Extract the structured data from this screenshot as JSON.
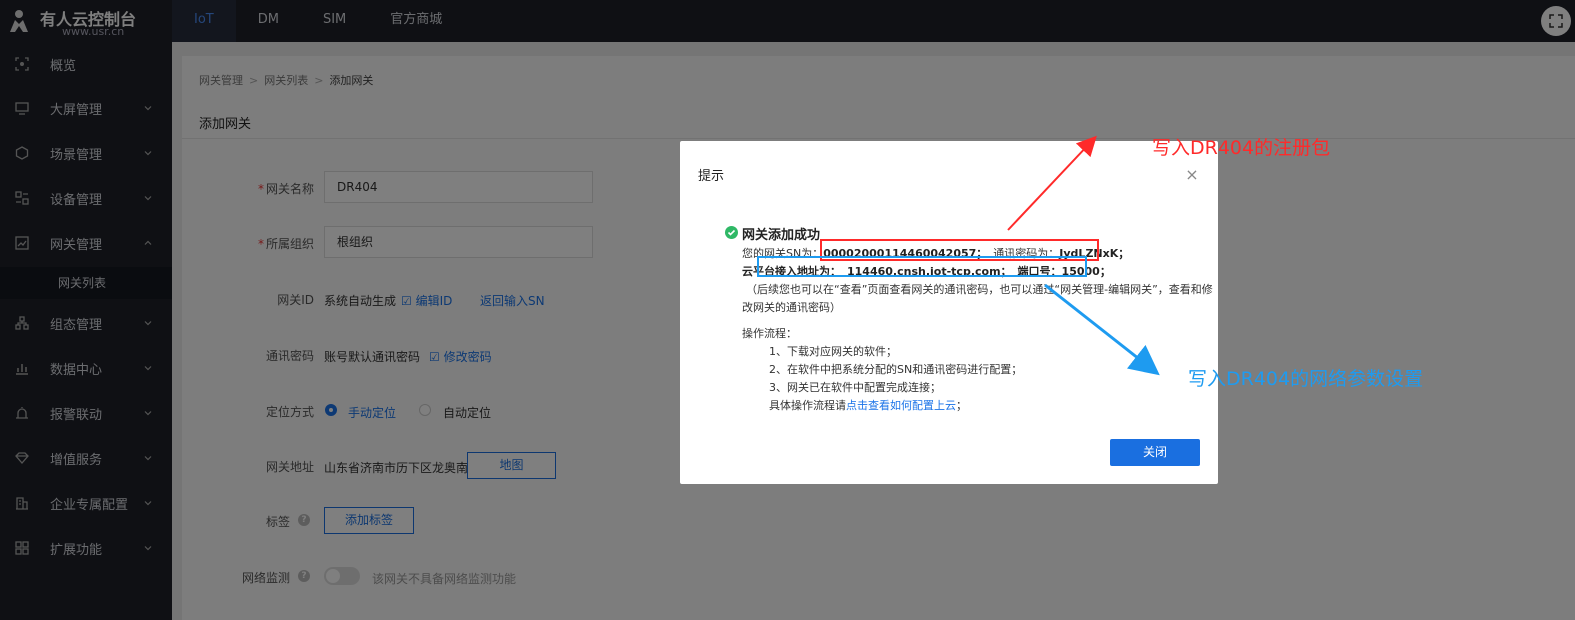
{
  "header": {
    "logo_title": "有人云控制台",
    "logo_url": "www.usr.cn",
    "nav": [
      {
        "label": "IoT",
        "active": true
      },
      {
        "label": "DM",
        "active": false
      },
      {
        "label": "SIM",
        "active": false
      },
      {
        "label": "官方商城",
        "active": false
      }
    ]
  },
  "sidebar": {
    "items": [
      {
        "label": "概览",
        "icon": "overview-icon"
      },
      {
        "label": "大屏管理",
        "icon": "screen-icon"
      },
      {
        "label": "场景管理",
        "icon": "scene-icon"
      },
      {
        "label": "设备管理",
        "icon": "device-icon"
      },
      {
        "label": "网关管理",
        "icon": "gateway-icon"
      },
      {
        "label": "网关列表",
        "icon": ""
      },
      {
        "label": "组态管理",
        "icon": "topology-icon"
      },
      {
        "label": "数据中心",
        "icon": "data-icon"
      },
      {
        "label": "报警联动",
        "icon": "alarm-icon"
      },
      {
        "label": "增值服务",
        "icon": "diamond-icon"
      },
      {
        "label": "企业专属配置",
        "icon": "enterprise-icon"
      },
      {
        "label": "扩展功能",
        "icon": "apps-icon"
      }
    ]
  },
  "breadcrumb": [
    "网关管理",
    "网关列表",
    "添加网关"
  ],
  "page_title": "添加网关",
  "form": {
    "name_label": "网关名称",
    "name_value": "DR404",
    "org_label": "所属组织",
    "org_value": "根组织",
    "id_label": "网关ID",
    "id_value": "系统自动生成",
    "id_edit": "编辑ID",
    "id_return": "返回输入SN",
    "pwd_label": "通讯密码",
    "pwd_value": "账号默认通讯密码",
    "pwd_edit": "修改密码",
    "loc_label": "定位方式",
    "loc_manual": "手动定位",
    "loc_auto": "自动定位",
    "addr_label": "网关地址",
    "addr_value": "山东省济南市历下区龙奥南路",
    "map_btn": "地图",
    "tag_label": "标签",
    "tag_btn": "添加标签",
    "monitor_label": "网络监测",
    "monitor_hint": "该网关不具备网络监测功能"
  },
  "modal": {
    "title": "提示",
    "success": "网关添加成功",
    "sn_line": "您的网关SN为：",
    "sn_value": "00002000114460042057；",
    "pwd_line": "通讯密码为：",
    "pwd_value": "JydLZNxK；",
    "addr_line": "云平台接入地址为：",
    "addr_value": "114460.cnsh.iot-tcp.com；",
    "port_line": "端口号：",
    "port_value": "15000；",
    "note1": "（后续您也可以在“查看”页面查看网关的通讯密码，也可以通过“网关管理-编辑网关”，查看和修",
    "note2": "改网关的通讯密码）",
    "process_title": "操作流程：",
    "step1": "1、下载对应网关的软件；",
    "step2": "2、在软件中把系统分配的SN和通讯密码进行配置；",
    "step3": "3、网关已在软件中配置完成连接；",
    "step4_pre": "具体操作流程请",
    "step4_link": "点击查看如何配置上云",
    "step4_post": "；",
    "close_btn": "关闭"
  },
  "annotations": {
    "red_text": "写入DR404的注册包",
    "blue_text": "写入DR404的网络参数设置",
    "red_color": "#ff2a2a",
    "blue_color": "#1e9bf0"
  }
}
